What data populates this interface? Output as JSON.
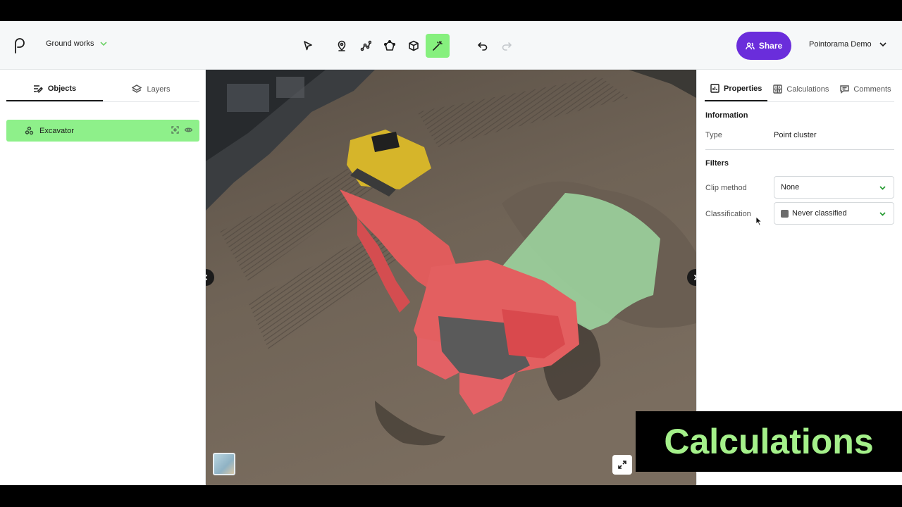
{
  "header": {
    "project_name": "Ground works",
    "share_label": "Share",
    "user_name": "Pointorama Demo",
    "brand_color": "#6a2ddb",
    "active_tool_color": "#86f07e"
  },
  "toolbar": {
    "tools": [
      "select-tool",
      "pin-tool",
      "polyline-tool",
      "polygon-tool",
      "box-tool",
      "magic-wand-tool",
      "undo",
      "redo"
    ],
    "active": "magic-wand-tool"
  },
  "left_panel": {
    "tabs": [
      {
        "label": "Objects",
        "active": true
      },
      {
        "label": "Layers",
        "active": false
      }
    ],
    "objects": [
      {
        "label": "Excavator",
        "selected": true
      }
    ]
  },
  "right_panel": {
    "tabs": [
      {
        "label": "Properties",
        "active": true
      },
      {
        "label": "Calculations",
        "active": false
      },
      {
        "label": "Comments",
        "active": false
      }
    ],
    "information_title": "Information",
    "type_label": "Type",
    "type_value": "Point cluster",
    "filters_title": "Filters",
    "clip_label": "Clip method",
    "clip_value": "None",
    "classification_label": "Classification",
    "classification_value": "Never classified",
    "classification_color": "#6b6b6b"
  },
  "overlay": {
    "caption": "Calculations",
    "caption_color": "#a4f08a"
  }
}
